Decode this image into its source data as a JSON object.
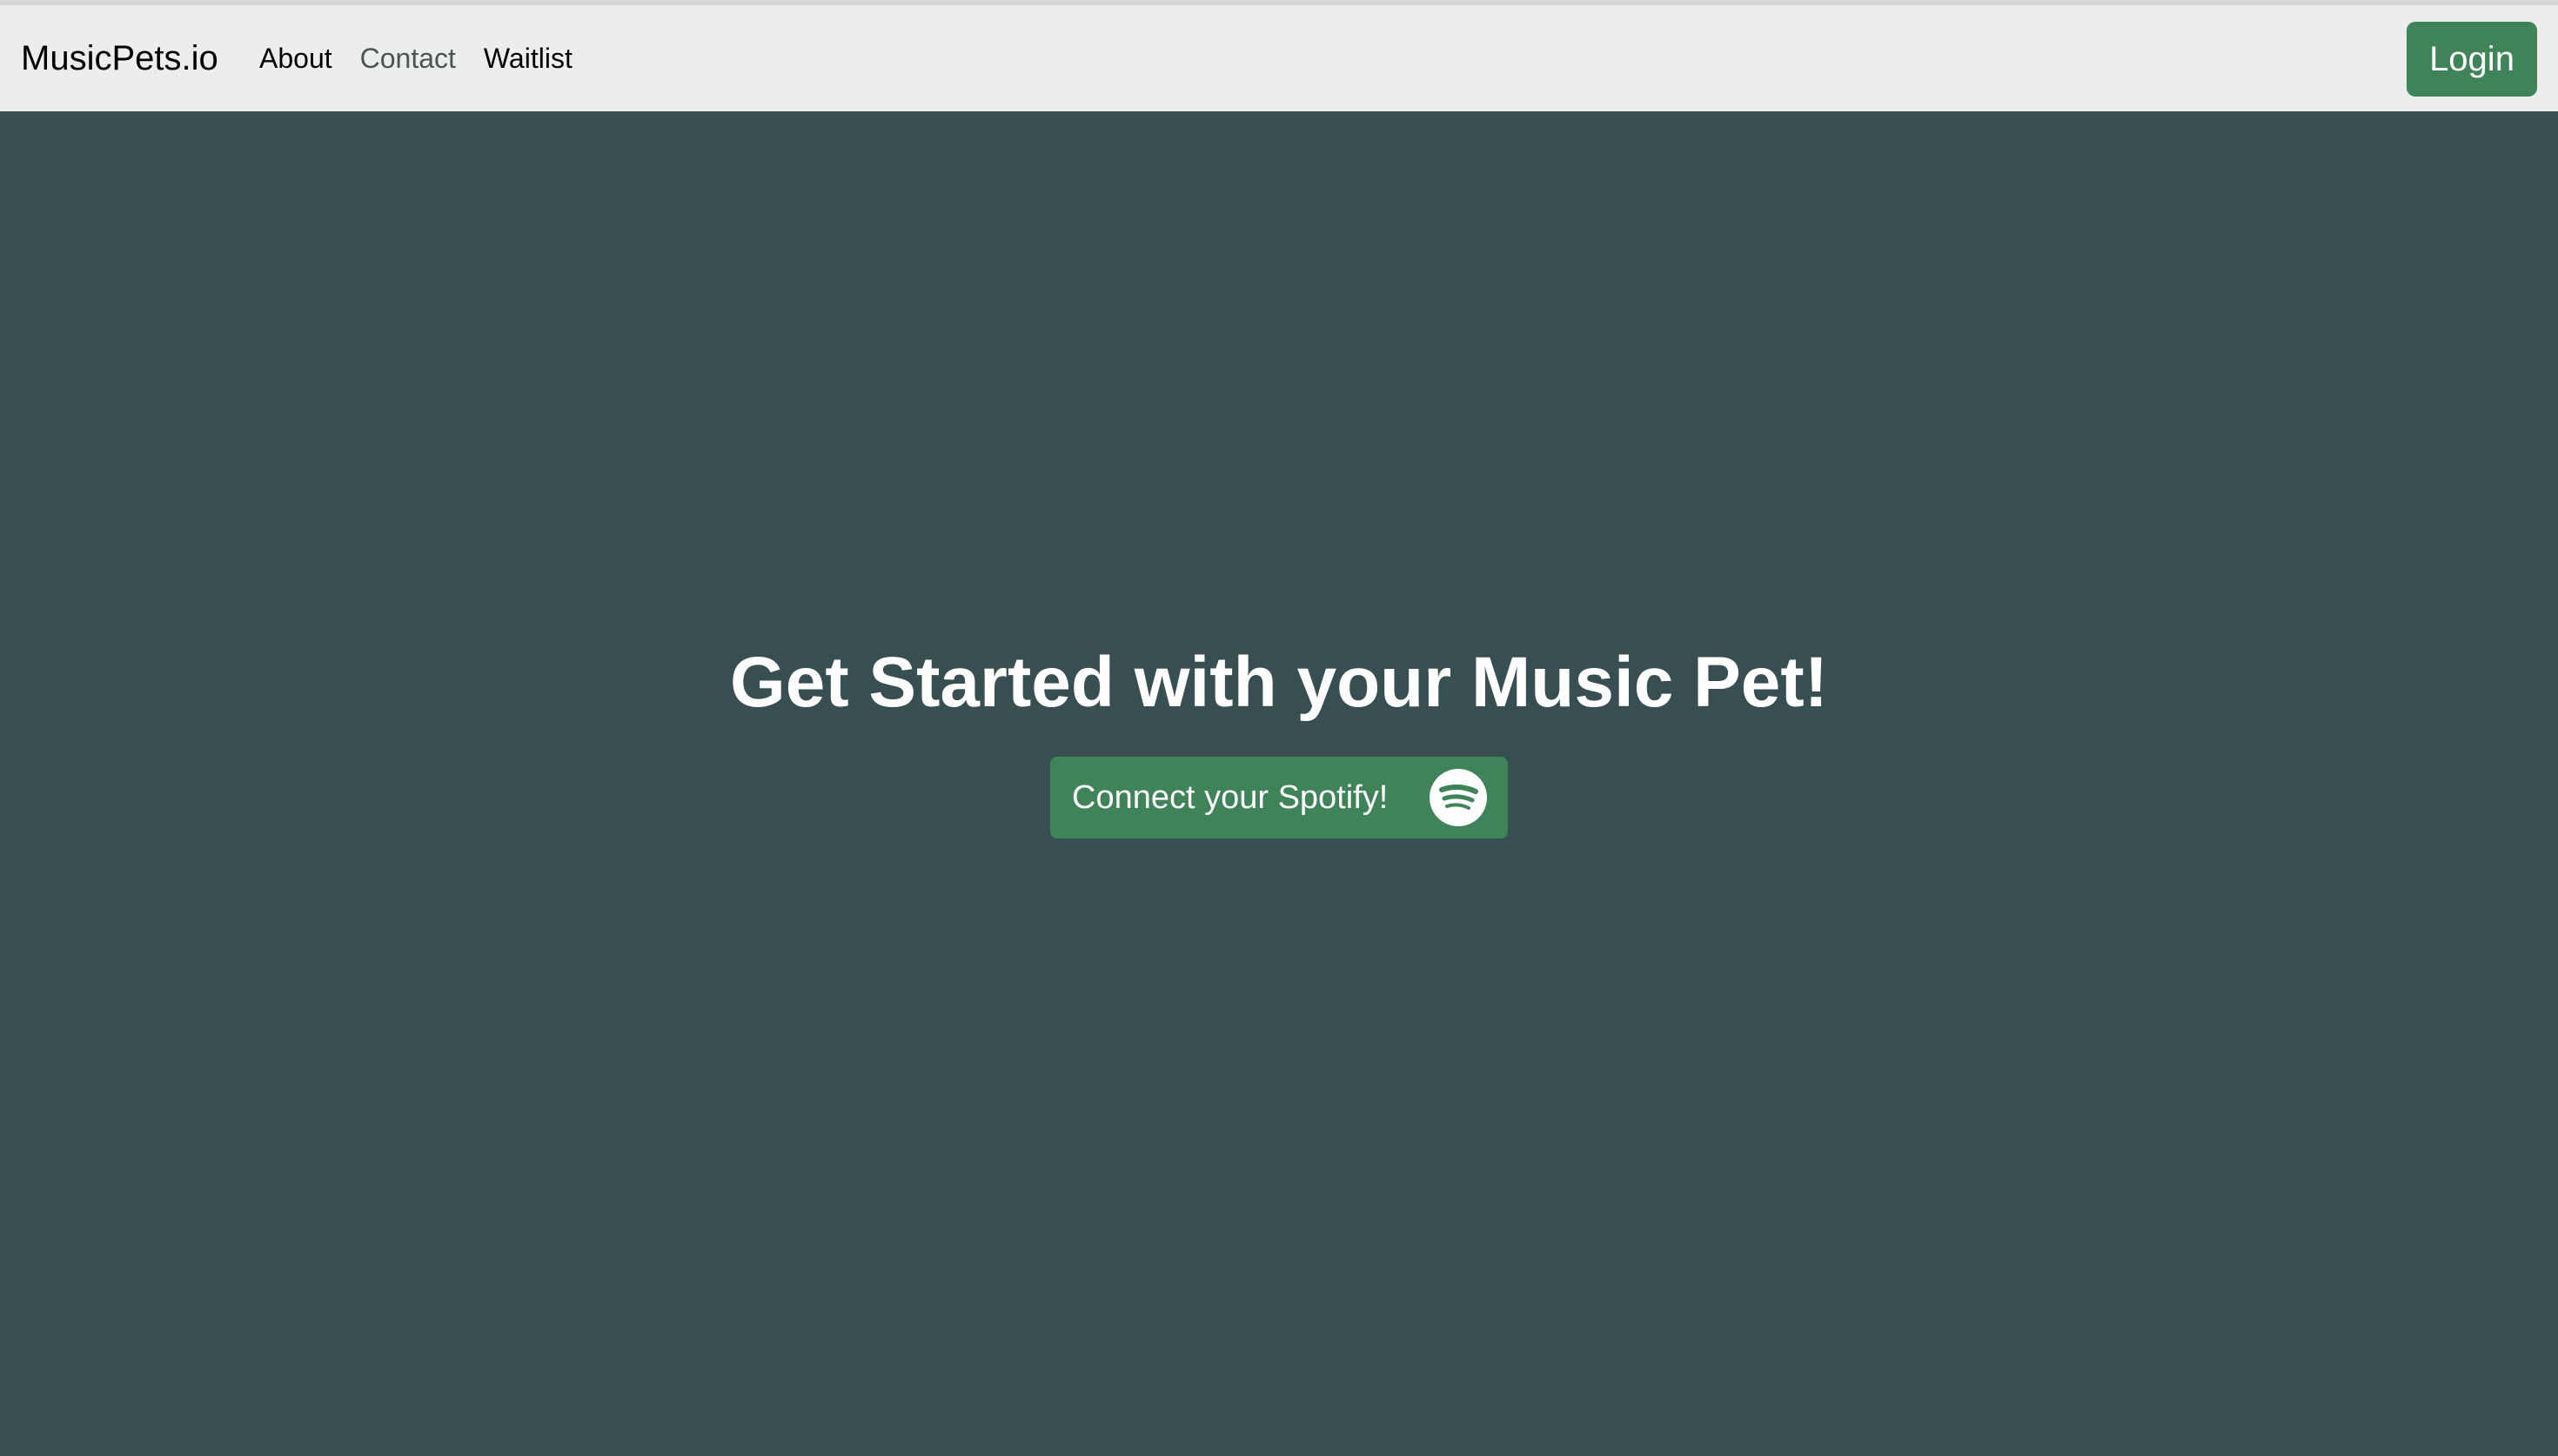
{
  "nav": {
    "brand": "MusicPets.io",
    "links": [
      {
        "label": "About"
      },
      {
        "label": "Contact"
      },
      {
        "label": "Waitlist"
      }
    ],
    "login_label": "Login"
  },
  "hero": {
    "title": "Get Started with your Music Pet!",
    "cta_label": "Connect your Spotify!",
    "cta_icon": "spotify-icon"
  },
  "colors": {
    "background": "#374f50",
    "navbar": "#eceeed",
    "accent_green": "#3f8458",
    "text_light": "#ffffff"
  }
}
